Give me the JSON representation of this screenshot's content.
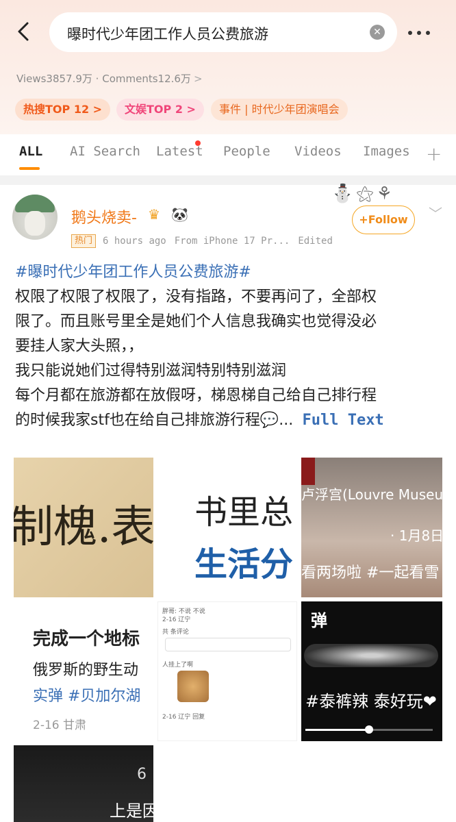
{
  "search": {
    "query": "曝时代少年团工作人员公费旅游",
    "clear_symbol": "✕"
  },
  "stats": {
    "views": "Views3857.9万",
    "separator": " · ",
    "comments": "Comments12.6万"
  },
  "chips": [
    {
      "label": "热搜TOP 12 >"
    },
    {
      "label": "文娱TOP 2 >"
    },
    {
      "label": "事件 | 时代少年团演唱会"
    }
  ],
  "tabs": [
    {
      "label": "ALL"
    },
    {
      "label": "AI Search"
    },
    {
      "label": "Latest"
    },
    {
      "label": "People"
    },
    {
      "label": "Videos"
    },
    {
      "label": "Images"
    }
  ],
  "post": {
    "username": "鹅头烧卖-",
    "hot_tag": "热门",
    "time": "6 hours ago",
    "source": "From iPhone 17 Pr...",
    "edited": "Edited",
    "follow_label": "Follow",
    "hashtag": "#曝时代少年团工作人员公费旅游#",
    "lines": [
      "权限了权限了权限了，没有指路，不要再问了，全部权",
      "限了。而且账号里全是她们个人信息我确实也觉得没必",
      "要挂人家大头照，，",
      "我只能说她们过得特别滋润特别特别滋润",
      "每个月都在旅游都在放假呀，梯恩梯自己给自己排行程",
      "的时候我家stf也在给自己排旅游行程"
    ],
    "ellipsis": "...",
    "full_text": " Full Text"
  },
  "images": {
    "t1_text": "制槐.表西",
    "t2_line1": "书里总",
    "t2_line2": "生活分",
    "t3_caption": "卢浮宫(Louvre Museu",
    "t3_date": "· 1月8日",
    "t3_caption2": "看两场啦 #一起看雪",
    "t4_line1": "完成一个地标",
    "t4_line2": "俄罗斯的野生动",
    "t4_line3": "实弹 #贝加尔湖",
    "t4_line4": "2-16  甘肃",
    "t5_mini1": "胖哥: 不说 不说",
    "t5_mini2": "2-16 辽宁",
    "t5_mini3": "共 条评论",
    "t5_mini4": "人挂上了啊",
    "t5_mini5": "2-16 辽宁   回复",
    "t6_dan": "弹",
    "t6_caption": "#泰裤辣 泰好玩❤",
    "t6_progress": 0.5,
    "t7_num": "6",
    "t7_caption": "上是因"
  },
  "colors": {
    "accent": "#ff8c00",
    "link": "#3a6fb5",
    "username": "#f07818"
  }
}
